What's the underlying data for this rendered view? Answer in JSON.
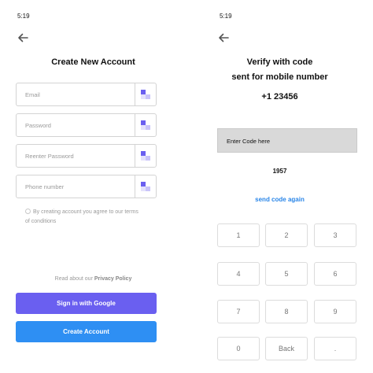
{
  "left_screen": {
    "status_time": "5:19",
    "title": "Create New Account",
    "fields": [
      {
        "placeholder": "Email"
      },
      {
        "placeholder": "Password"
      },
      {
        "placeholder": "Reenter Password"
      },
      {
        "placeholder": "Phone number"
      }
    ],
    "terms_text": "By creating account you agree to our terms of conditions",
    "privacy_prefix": "Read about our",
    "privacy_link": "Privacy Policy",
    "google_button": "Sign in with Google",
    "create_button": "Create Account",
    "google_color": "#6a5ff0",
    "create_color": "#2e8ff3"
  },
  "right_screen": {
    "status_time": "5:19",
    "title_line1": "Verify with code",
    "title_line2": "sent for mobile number",
    "phone_number": "+1 23456",
    "code_box_label": "Enter Code here",
    "entered_code": "1957",
    "resend_link": "send code again",
    "resend_color": "#2a86e8",
    "keypad": [
      "1",
      "2",
      "3",
      "4",
      "5",
      "6",
      "7",
      "8",
      "9",
      "0",
      "Back",
      "."
    ]
  }
}
